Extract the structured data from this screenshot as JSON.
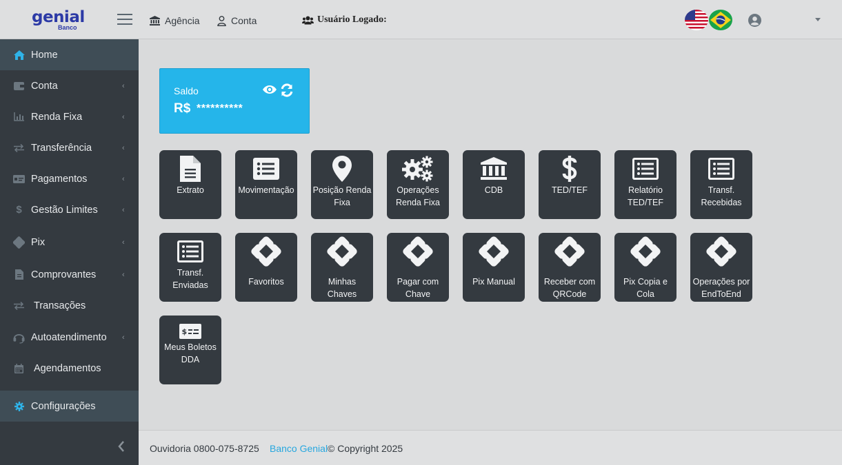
{
  "header": {
    "logo_main": "genial",
    "logo_sub": "Banco",
    "nav_agencia": "Agência",
    "nav_conta": "Conta",
    "user_logged_label": "Usuário Logado:"
  },
  "sidebar": {
    "items": [
      {
        "label": "Home",
        "icon": "home-icon"
      },
      {
        "label": "Conta",
        "icon": "wallet-icon"
      },
      {
        "label": "Renda Fixa",
        "icon": "chart-icon"
      },
      {
        "label": "Transferência",
        "icon": "transfer-icon"
      },
      {
        "label": "Pagamentos",
        "icon": "money-check-icon"
      },
      {
        "label": "Gestão Limites",
        "icon": "dollar-icon"
      },
      {
        "label": "Pix",
        "icon": "pix-icon"
      },
      {
        "label": "Comprovantes",
        "icon": "file-icon"
      },
      {
        "label": "Transações",
        "icon": "exchange-icon"
      },
      {
        "label": "Autoatendimento",
        "icon": "headset-icon"
      },
      {
        "label": "Agendamentos",
        "icon": "calendar-icon"
      },
      {
        "label": "Configurações",
        "icon": "gear-icon"
      }
    ]
  },
  "balance": {
    "title": "Saldo",
    "currency": "R$",
    "masked_value": "**********"
  },
  "tiles": [
    {
      "label": "Extrato",
      "icon": "document-icon"
    },
    {
      "label": "Movimentação",
      "icon": "list-icon"
    },
    {
      "label": "Posição Renda Fixa",
      "icon": "map-marker-icon"
    },
    {
      "label": "Operações Renda Fixa",
      "icon": "gears-icon"
    },
    {
      "label": "CDB",
      "icon": "bank-icon"
    },
    {
      "label": "TED/TEF",
      "icon": "dollar-icon"
    },
    {
      "label": "Relatório TED/TEF",
      "icon": "list-icon"
    },
    {
      "label": "Transf. Recebidas",
      "icon": "list-icon"
    },
    {
      "label": "Transf. Enviadas",
      "icon": "list-icon"
    },
    {
      "label": "Favoritos",
      "icon": "pix-icon"
    },
    {
      "label": "Minhas Chaves",
      "icon": "pix-icon"
    },
    {
      "label": "Pagar com Chave",
      "icon": "pix-icon"
    },
    {
      "label": "Pix Manual",
      "icon": "pix-icon"
    },
    {
      "label": "Receber com QRCode",
      "icon": "pix-icon"
    },
    {
      "label": "Pix Copia e Cola",
      "icon": "pix-icon"
    },
    {
      "label": "Operações por EndToEnd",
      "icon": "pix-icon"
    },
    {
      "label": "Meus Boletos DDA",
      "icon": "money-check-icon"
    }
  ],
  "footer": {
    "ouvidoria": "Ouvidoria 0800-075-8725",
    "brand": "Banco Genial",
    "copyright": "© Copyright 2025"
  },
  "colors": {
    "accent": "#25b5ea",
    "sidebar_bg": "#343a40",
    "tile_bg": "#343a40",
    "logo": "#2c3aa6"
  }
}
